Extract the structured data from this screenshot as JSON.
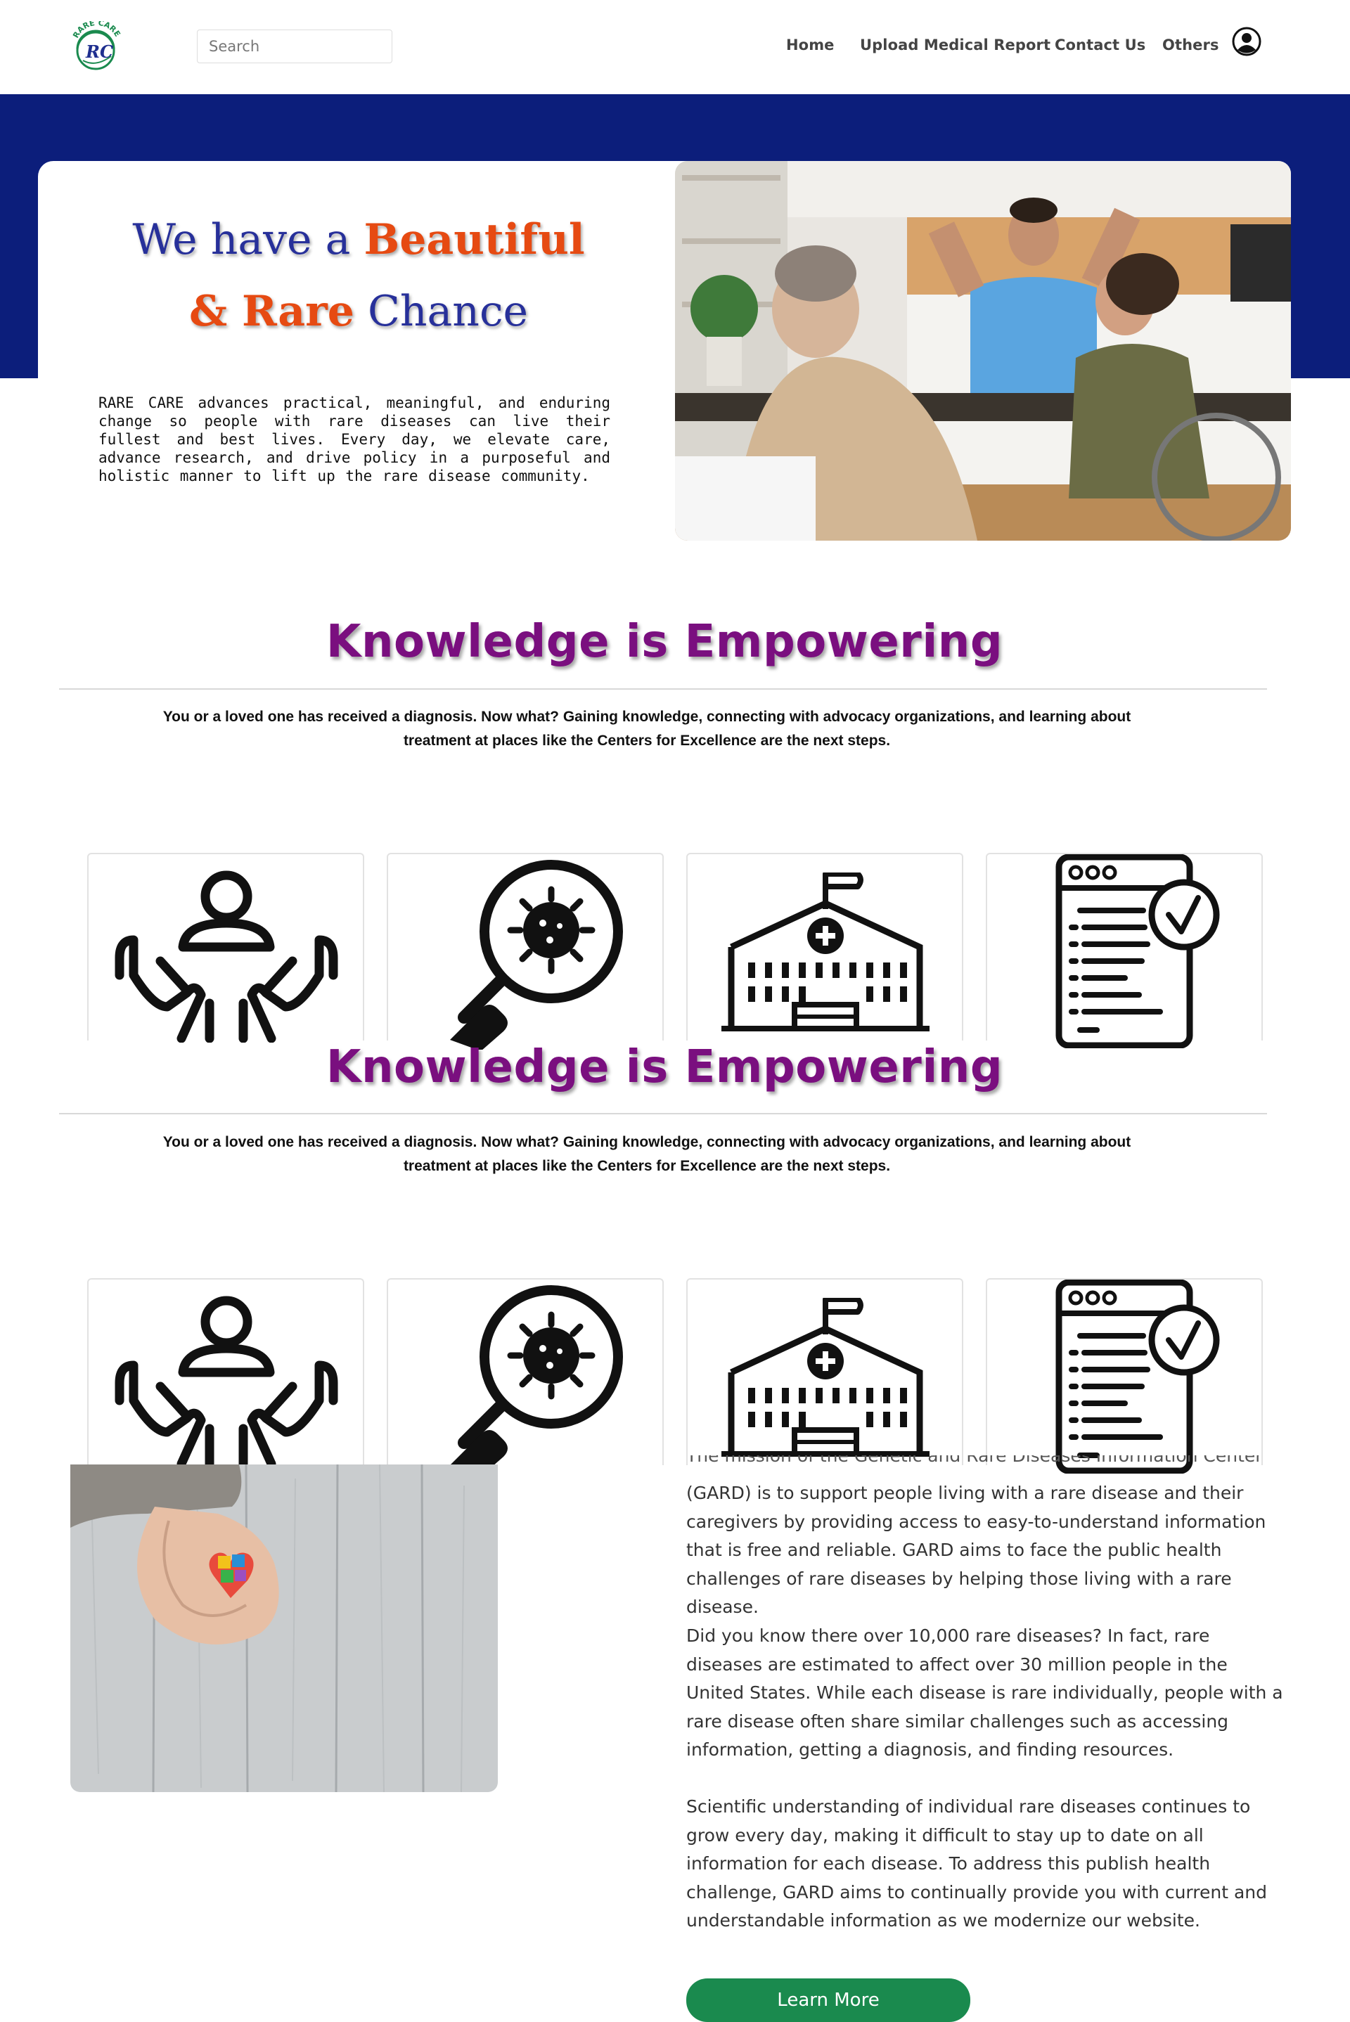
{
  "logo": {
    "brand_text": "RARE CARE",
    "monogram": "RC"
  },
  "search": {
    "placeholder": "Search"
  },
  "nav": {
    "home": "Home",
    "upload": "Upload Medical Report",
    "contact": "Contact Us",
    "others": "Others"
  },
  "hero": {
    "title_part1": "We have a ",
    "title_part2": "Beautiful",
    "title_part3": "& Rare",
    "title_part4": " Chance",
    "description": "RARE CARE advances practical, meaningful, and enduring change so people with rare diseases can live their fullest and best lives. Every day, we elevate care, advance research, and drive policy in a purposeful and holistic manner to lift up the rare disease community."
  },
  "knowledge": {
    "title": "Knowledge is Empowering",
    "description_line1": "You or a loved one has received a diagnosis. Now what? Gaining knowledge, connecting with advocacy organizations, and learning about",
    "description_line2": "treatment at places like the Centers for Excellence are the next steps."
  },
  "gard": {
    "para_top_partial": "The mission of the Genetic and Rare Diseases Information Center",
    "para1": "(GARD) is to support people living with a rare disease and their caregivers by providing access to easy-to-understand information that is free and reliable. GARD aims to face the public health challenges of rare diseases by helping those living with a rare disease.",
    "para2": "Did you know there over 10,000 rare diseases? In fact, rare diseases are estimated to affect over 30 million people in the United States. While each disease is rare individually, people with a rare disease often share similar challenges such as accessing information, getting a diagnosis, and finding resources.",
    "para3": "Scientific understanding of individual rare diseases continues to grow every day, making it difficult to stay up to date on all information for each disease. To address this publish health challenge, GARD aims to continually provide you with current and understandable information as we modernize our website.",
    "button": "Learn More"
  },
  "colors": {
    "hero_band": "#0c1e7b",
    "title_purple": "#7a0f7f",
    "title_blue": "#27309a",
    "title_orange": "#e64a12",
    "button_green": "#1a8a4e"
  },
  "icons": [
    "care-hands-icon",
    "virus-magnifier-icon",
    "hospital-icon",
    "checklist-document-icon",
    "user-profile-icon"
  ]
}
